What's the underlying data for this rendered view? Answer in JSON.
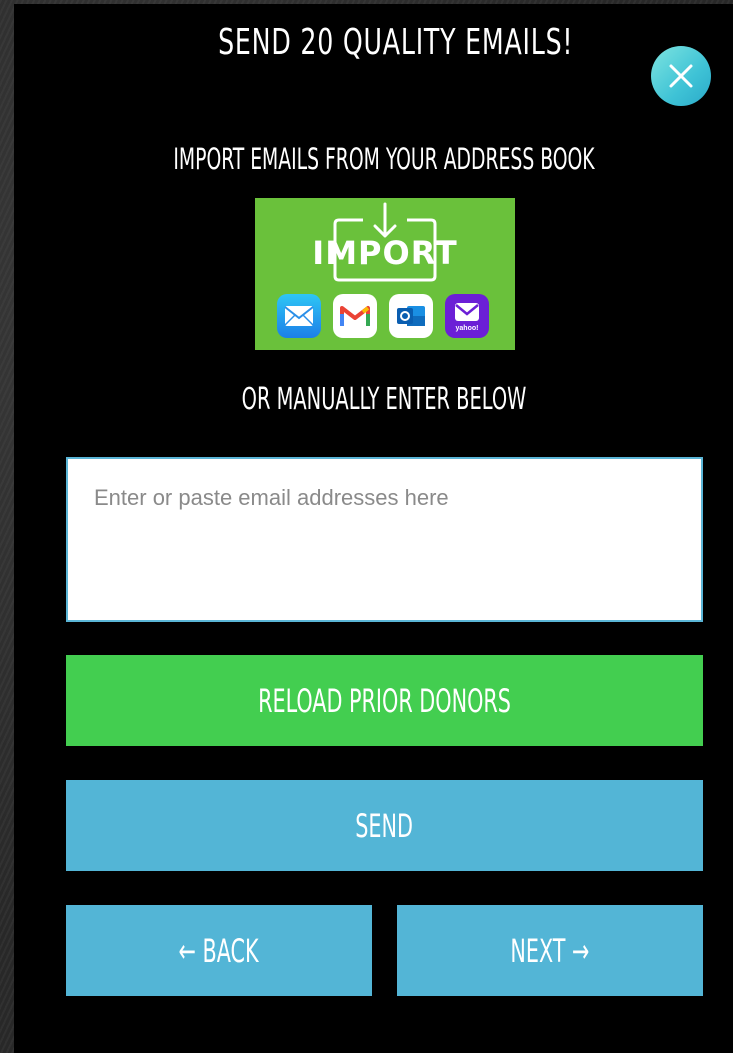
{
  "modal": {
    "title": "SEND 20 QUALITY EMAILS!",
    "close_icon": "close-icon",
    "subtitle": "IMPORT EMAILS FROM YOUR ADDRESS BOOK",
    "import_button": {
      "label": "IMPORT",
      "icons": [
        "mail-app-icon",
        "gmail-icon",
        "outlook-icon",
        "yahoo-mail-icon"
      ],
      "yahoo_label": "yahoo!"
    },
    "manual_label": "OR MANUALLY ENTER BELOW",
    "email_input": {
      "value": "",
      "placeholder": "Enter or paste email addresses here"
    },
    "reload_button": "RELOAD PRIOR DONORS",
    "send_button": "SEND",
    "back_button": "← BACK",
    "next_button": "NEXT →"
  },
  "colors": {
    "modal_bg": "#000000",
    "green_button": "#43ce50",
    "blue_button": "#53b5d6",
    "import_bg": "#6ac13b",
    "close_accent": "#3fc3d6"
  }
}
